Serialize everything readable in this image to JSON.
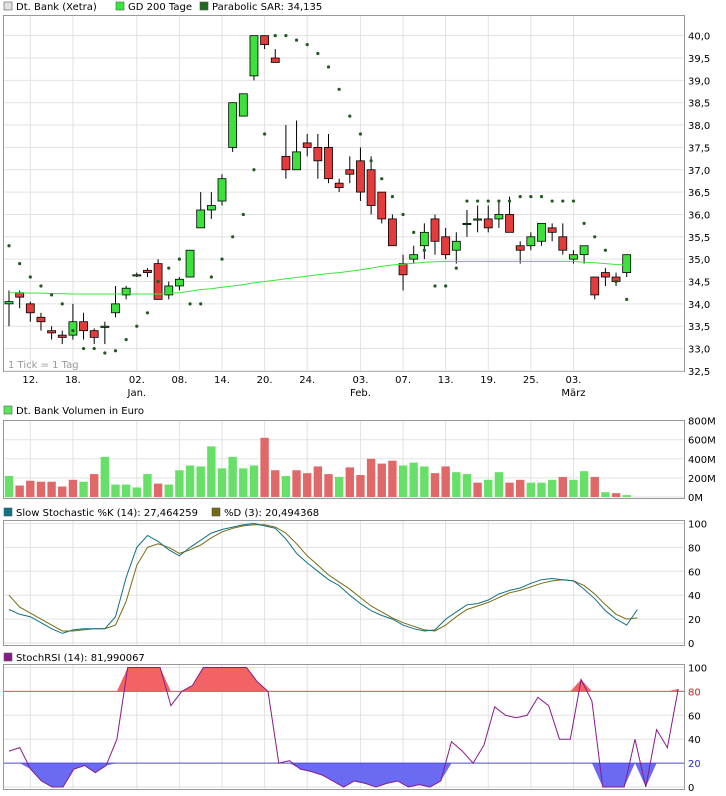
{
  "legend": {
    "price": {
      "label": "Dt. Bank (Xetra)",
      "color": "#e3e3e3"
    },
    "gd200": {
      "label": "GD 200 Tage",
      "color": "#38e838"
    },
    "sar": {
      "label": "Parabolic SAR: 34,135",
      "color": "#1f6a1f"
    },
    "volume": {
      "label": "Dt. Bank Volumen in Euro",
      "color": "#59e859"
    },
    "stoch_k": {
      "label": "Slow Stochastic %K (14): 27,464259",
      "color": "#0f7282"
    },
    "stoch_d": {
      "label": "%D (3): 20,494368",
      "color": "#7a6a10"
    },
    "stochrsi": {
      "label": "StochRSI (14): 81,990067",
      "color": "#8a1a8a"
    }
  },
  "note": "1 Tick = 1 Tag",
  "x_axis": {
    "labels": [
      "12.",
      "18.",
      "02.",
      "08.",
      "14.",
      "20.",
      "24.",
      "03.",
      "07.",
      "13.",
      "19.",
      "25.",
      "03."
    ],
    "label_bars": [
      2,
      6,
      12,
      16,
      20,
      24,
      28,
      33,
      37,
      41,
      45,
      49,
      53
    ],
    "months": [
      {
        "label": "Jan.",
        "bar": 12
      },
      {
        "label": "Feb.",
        "bar": 33
      },
      {
        "label": "März",
        "bar": 53
      }
    ]
  },
  "chart_data": [
    {
      "type": "candlestick",
      "title": "Dt. Bank (Xetra)",
      "ylim": [
        32.0,
        40.2
      ],
      "y_ticks": [
        "32,5",
        "33,0",
        "33,5",
        "34,0",
        "34,5",
        "35,0",
        "35,5",
        "36,0",
        "36,5",
        "37,0",
        "37,5",
        "38,0",
        "38,5",
        "39,0",
        "39,5",
        "40,0"
      ],
      "y_tick_values": [
        32.5,
        33.0,
        33.5,
        34.0,
        34.5,
        35.0,
        35.5,
        36.0,
        36.5,
        37.0,
        37.5,
        38.0,
        38.5,
        39.0,
        39.5,
        40.0
      ],
      "candles_ohlc": [
        [
          34.0,
          34.3,
          33.5,
          34.05
        ],
        [
          34.25,
          34.3,
          33.9,
          34.15
        ],
        [
          34.0,
          34.05,
          33.6,
          33.8
        ],
        [
          33.7,
          33.8,
          33.4,
          33.6
        ],
        [
          33.4,
          33.5,
          33.2,
          33.35
        ],
        [
          33.3,
          33.4,
          33.1,
          33.25
        ],
        [
          33.3,
          34.0,
          33.2,
          33.6
        ],
        [
          33.6,
          33.8,
          33.2,
          33.4
        ],
        [
          33.4,
          33.45,
          33.1,
          33.25
        ],
        [
          33.5,
          33.6,
          33.1,
          33.5
        ],
        [
          33.8,
          34.4,
          33.7,
          34.0
        ],
        [
          34.2,
          34.4,
          34.1,
          34.35
        ],
        [
          34.65,
          34.7,
          34.6,
          34.65
        ],
        [
          34.75,
          34.8,
          34.6,
          34.7
        ],
        [
          34.9,
          35.0,
          34.1,
          34.1
        ],
        [
          34.2,
          34.5,
          34.1,
          34.4
        ],
        [
          34.4,
          34.6,
          34.3,
          34.55
        ],
        [
          34.6,
          35.2,
          34.6,
          35.2
        ],
        [
          35.7,
          36.5,
          35.7,
          36.1
        ],
        [
          36.1,
          36.5,
          35.9,
          36.2
        ],
        [
          36.3,
          36.9,
          36.2,
          36.8
        ],
        [
          37.5,
          38.5,
          37.4,
          38.5
        ],
        [
          38.2,
          38.6,
          38.2,
          38.7
        ],
        [
          39.1,
          39.9,
          39.0,
          40.0
        ],
        [
          40.0,
          40.0,
          39.7,
          39.8
        ],
        [
          39.5,
          39.7,
          39.4,
          39.4
        ],
        [
          37.3,
          38.0,
          36.8,
          37.0
        ],
        [
          37.0,
          38.1,
          37.0,
          37.4
        ],
        [
          37.6,
          37.8,
          37.3,
          37.5
        ],
        [
          37.5,
          37.8,
          36.8,
          37.2
        ],
        [
          37.5,
          37.8,
          36.7,
          36.8
        ],
        [
          36.7,
          36.8,
          36.5,
          36.6
        ],
        [
          37.0,
          37.3,
          36.7,
          36.9
        ],
        [
          37.2,
          37.5,
          36.3,
          36.5
        ],
        [
          37.0,
          37.3,
          36.0,
          36.2
        ],
        [
          36.5,
          36.5,
          35.8,
          35.9
        ],
        [
          35.9,
          36.0,
          35.3,
          35.3
        ],
        [
          34.9,
          35.1,
          34.3,
          34.65
        ],
        [
          35.0,
          35.3,
          34.9,
          35.1
        ],
        [
          35.3,
          35.8,
          35.0,
          35.6
        ],
        [
          35.9,
          36.0,
          35.1,
          35.4
        ],
        [
          35.5,
          35.7,
          35.0,
          35.1
        ],
        [
          35.2,
          35.6,
          34.9,
          35.4
        ],
        [
          35.8,
          36.1,
          35.5,
          35.8
        ],
        [
          35.9,
          36.2,
          35.6,
          35.9
        ],
        [
          35.9,
          36.2,
          35.6,
          35.7
        ],
        [
          35.9,
          36.3,
          35.7,
          36.0
        ],
        [
          36.0,
          36.4,
          35.6,
          35.6
        ],
        [
          35.3,
          35.4,
          34.9,
          35.2
        ],
        [
          35.3,
          35.6,
          35.2,
          35.5
        ],
        [
          35.4,
          35.8,
          35.3,
          35.8
        ],
        [
          35.7,
          35.8,
          35.4,
          35.6
        ],
        [
          35.5,
          35.8,
          35.1,
          35.2
        ],
        [
          35.0,
          35.2,
          34.9,
          35.1
        ],
        [
          35.1,
          35.3,
          34.9,
          35.3
        ],
        [
          34.6,
          34.6,
          34.1,
          34.2
        ],
        [
          34.7,
          34.8,
          34.4,
          34.6
        ],
        [
          34.6,
          34.7,
          34.4,
          34.5
        ],
        [
          34.7,
          35.1,
          34.6,
          35.1
        ]
      ],
      "gd200": [
        34.25,
        34.25,
        34.24,
        34.24,
        34.23,
        34.23,
        34.22,
        34.22,
        34.22,
        34.22,
        34.22,
        34.22,
        34.22,
        34.22,
        34.22,
        34.23,
        34.25,
        34.28,
        34.32,
        34.34,
        34.37,
        34.4,
        34.43,
        34.47,
        34.5,
        34.53,
        34.56,
        34.59,
        34.62,
        34.65,
        34.68,
        34.7,
        34.73,
        34.76,
        34.8,
        34.84,
        34.87,
        34.89,
        34.91,
        34.93,
        34.94,
        34.95,
        34.95,
        34.95,
        34.95,
        34.95,
        34.95,
        34.95,
        34.95,
        34.95,
        34.95,
        34.95,
        34.95,
        34.95,
        34.93,
        34.92,
        34.9,
        34.88,
        34.87
      ],
      "sar": [
        35.3,
        34.9,
        34.6,
        34.4,
        34.2,
        34.0,
        33.4,
        33.0,
        33.0,
        32.9,
        32.95,
        33.2,
        33.5,
        33.8,
        34.5,
        34.8,
        35.0,
        34.0,
        34.0,
        34.6,
        35.0,
        35.5,
        36.0,
        37.0,
        37.8,
        40.0,
        40.0,
        39.9,
        39.8,
        39.6,
        39.3,
        38.8,
        38.2,
        37.8,
        37.2,
        36.8,
        36.4,
        36.0,
        35.6,
        35.2,
        34.4,
        34.4,
        34.8,
        36.3,
        36.3,
        36.3,
        36.3,
        36.3,
        36.4,
        36.4,
        36.4,
        36.3,
        36.3,
        36.3,
        35.8,
        35.5,
        35.2,
        34.5,
        34.1
      ]
    },
    {
      "type": "bar",
      "title": "Dt. Bank Volumen in Euro",
      "ylim": [
        0,
        800
      ],
      "y_ticks": [
        "0M",
        "200M",
        "400M",
        "600M",
        "800M"
      ],
      "y_tick_values": [
        0,
        200,
        400,
        600,
        800
      ],
      "values": [
        220,
        120,
        170,
        160,
        160,
        110,
        180,
        160,
        240,
        420,
        130,
        130,
        100,
        240,
        140,
        130,
        280,
        330,
        320,
        530,
        300,
        420,
        300,
        330,
        620,
        280,
        220,
        280,
        250,
        320,
        240,
        210,
        310,
        230,
        400,
        350,
        380,
        330,
        360,
        320,
        250,
        320,
        260,
        240,
        150,
        180,
        260,
        150,
        180,
        150,
        150,
        180,
        210,
        180,
        270,
        210,
        50,
        40,
        20
      ],
      "up": [
        1,
        0,
        0,
        0,
        0,
        0,
        0,
        1,
        0,
        1,
        1,
        1,
        1,
        1,
        0,
        1,
        1,
        1,
        1,
        1,
        1,
        1,
        1,
        1,
        0,
        0,
        1,
        0,
        0,
        0,
        0,
        1,
        0,
        0,
        0,
        0,
        0,
        1,
        1,
        1,
        0,
        0,
        1,
        1,
        0,
        1,
        1,
        0,
        0,
        1,
        1,
        1,
        0,
        1,
        1,
        0,
        1,
        0,
        1
      ]
    },
    {
      "type": "line",
      "title": "Slow Stochastic",
      "ylim": [
        0,
        100
      ],
      "y_ticks": [
        "0",
        "20",
        "40",
        "60",
        "80",
        "100"
      ],
      "y_tick_values": [
        0,
        20,
        40,
        60,
        80,
        100
      ],
      "series": [
        {
          "name": "Slow Stochastic %K (14): 27,464259",
          "values": [
            28,
            24,
            22,
            17,
            12,
            8,
            11,
            12,
            12,
            12,
            22,
            55,
            80,
            90,
            85,
            78,
            73,
            80,
            86,
            92,
            95,
            97,
            99,
            100,
            98,
            96,
            87,
            75,
            67,
            60,
            53,
            48,
            40,
            33,
            27,
            23,
            20,
            15,
            12,
            10,
            11,
            20,
            26,
            32,
            33,
            36,
            41,
            44,
            46,
            50,
            53,
            54,
            53,
            52,
            45,
            37,
            27,
            20,
            15,
            28
          ]
        },
        {
          "name": "%D (3): 20,494368",
          "values": [
            40,
            30,
            25,
            20,
            15,
            10,
            10,
            11,
            12,
            12,
            15,
            35,
            65,
            80,
            83,
            80,
            75,
            78,
            82,
            88,
            93,
            96,
            98,
            99,
            99,
            97,
            92,
            83,
            73,
            65,
            57,
            51,
            45,
            38,
            31,
            26,
            21,
            17,
            14,
            11,
            10,
            15,
            22,
            28,
            31,
            34,
            38,
            42,
            44,
            47,
            50,
            52,
            53,
            52,
            48,
            41,
            32,
            24,
            20,
            21
          ]
        }
      ]
    },
    {
      "type": "line",
      "title": "StochRSI (14)",
      "ylim": [
        0,
        100
      ],
      "y_ticks": [
        "0",
        "20",
        "40",
        "60",
        "80",
        "100"
      ],
      "y_tick_values": [
        0,
        20,
        40,
        60,
        80,
        100
      ],
      "bands": [
        20,
        80
      ],
      "series": [
        {
          "name": "StochRSI (14): 81,990067",
          "values": [
            30,
            33,
            15,
            5,
            0,
            0,
            15,
            18,
            12,
            18,
            40,
            100,
            100,
            100,
            100,
            68,
            80,
            85,
            100,
            100,
            100,
            100,
            100,
            88,
            80,
            20,
            22,
            15,
            13,
            10,
            5,
            0,
            5,
            3,
            0,
            3,
            5,
            0,
            2,
            0,
            5,
            38,
            30,
            20,
            35,
            67,
            60,
            58,
            60,
            75,
            68,
            40,
            40,
            90,
            72,
            0,
            0,
            0,
            40,
            0,
            48,
            33,
            82
          ]
        }
      ]
    }
  ]
}
